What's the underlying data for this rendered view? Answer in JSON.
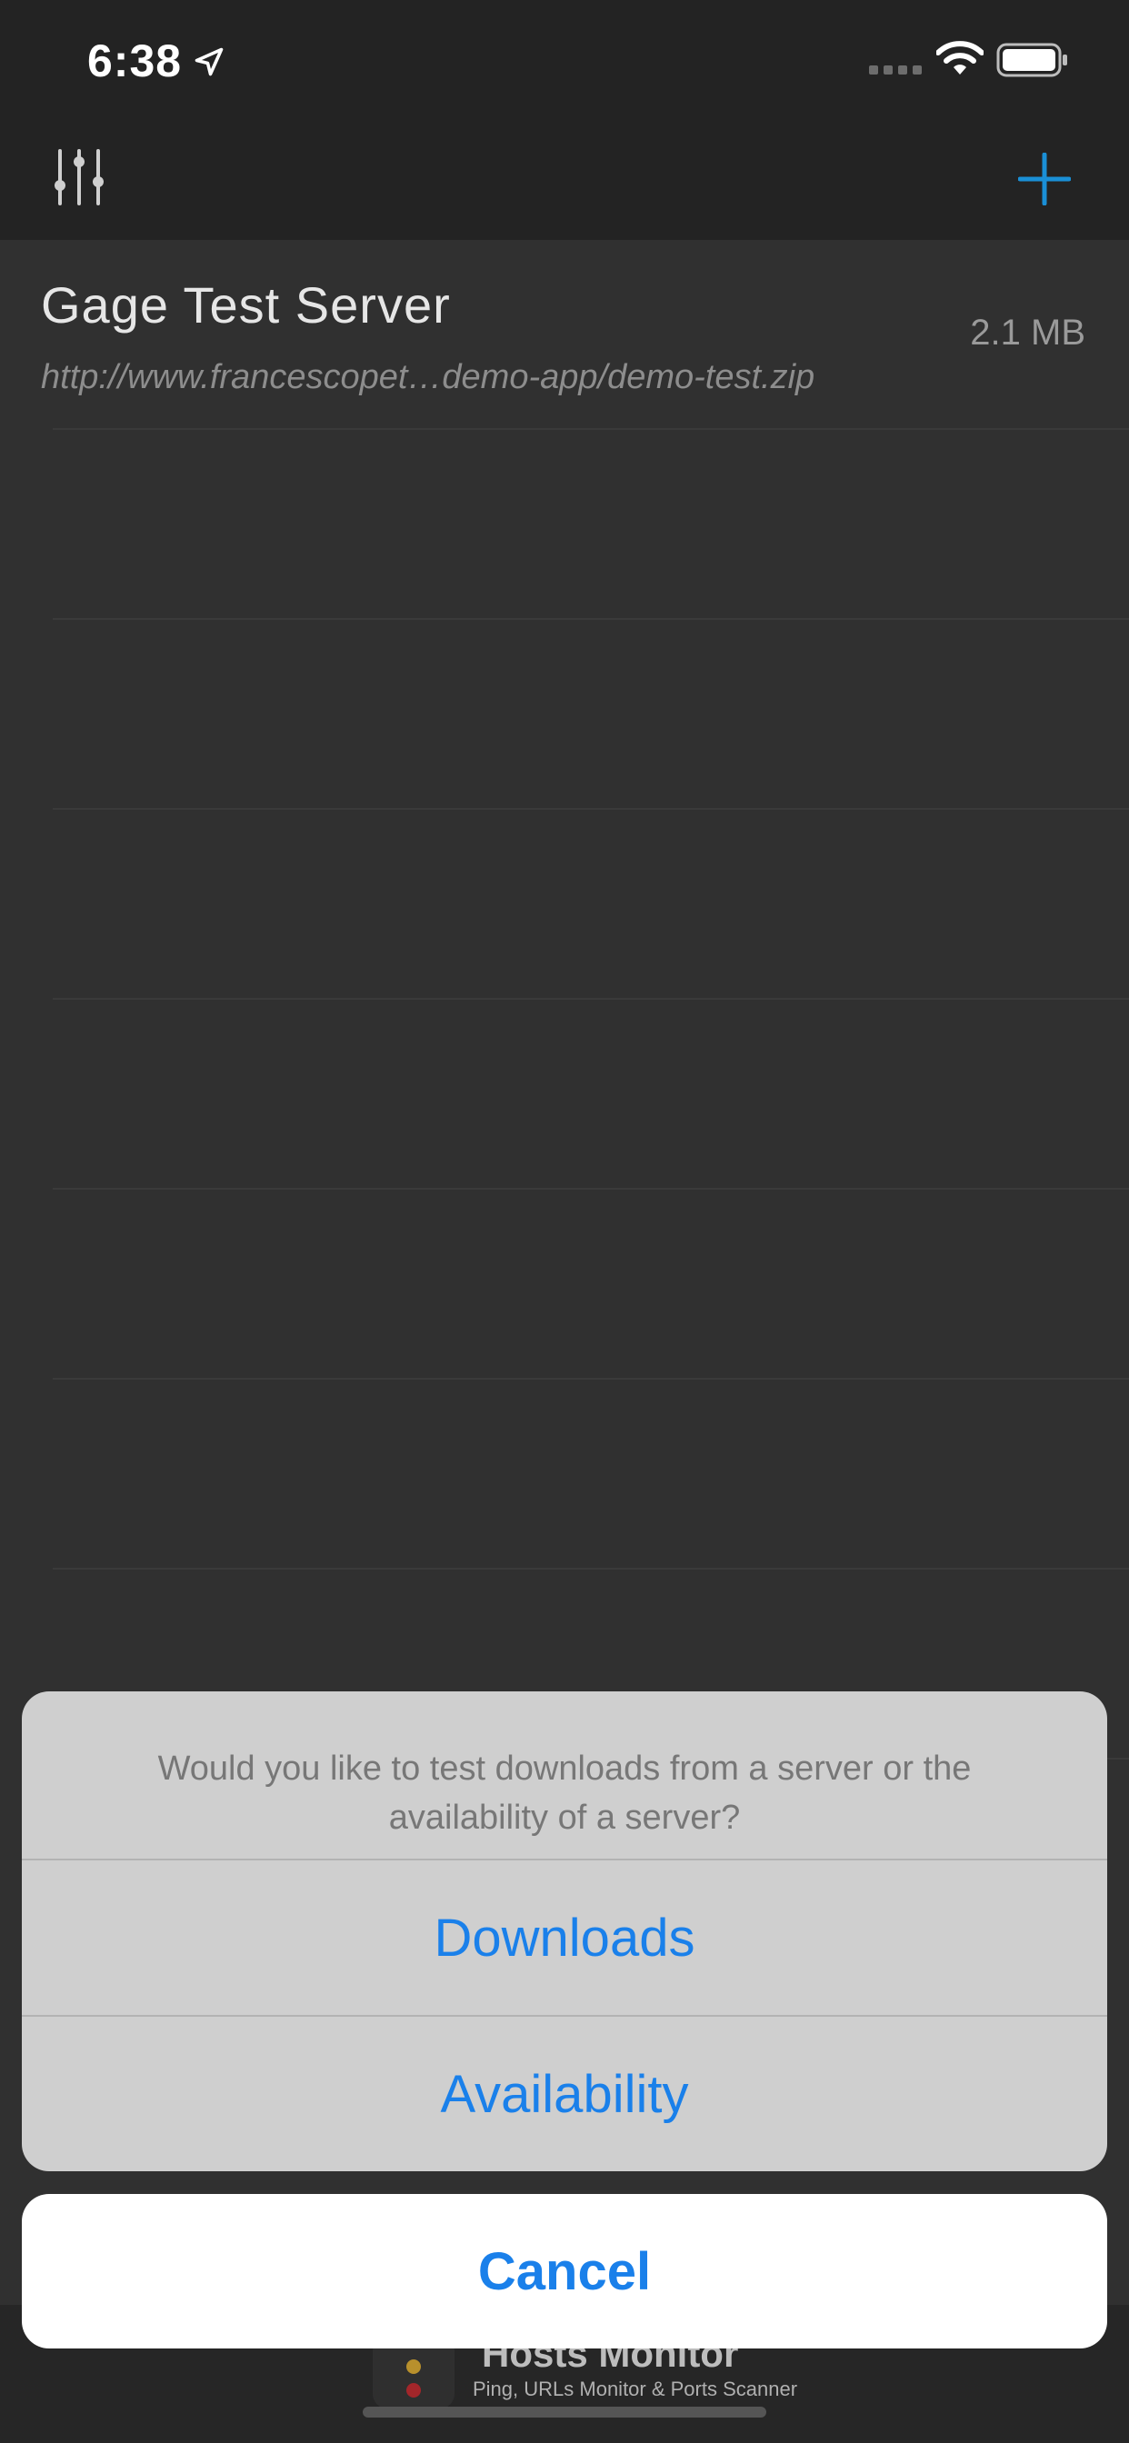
{
  "status_bar": {
    "time": "6:38"
  },
  "nav_bar": {
    "left_icon": "sliders-icon",
    "right_icon": "plus-icon",
    "accent_color": "#1a8fd6"
  },
  "list": {
    "items": [
      {
        "name": "Gage Test Server",
        "url": "http://www.francescopet…demo-app/demo-test.zip",
        "size": "2.1 MB"
      }
    ]
  },
  "banner": {
    "title": "Hosts Monitor",
    "subtitle": "Ping, URLs Monitor & Ports Scanner"
  },
  "action_sheet": {
    "message": "Would you like to test downloads from a server or the availability of a server?",
    "buttons": {
      "downloads": "Downloads",
      "availability": "Availability",
      "cancel": "Cancel"
    },
    "button_color": "#1a80ea"
  }
}
